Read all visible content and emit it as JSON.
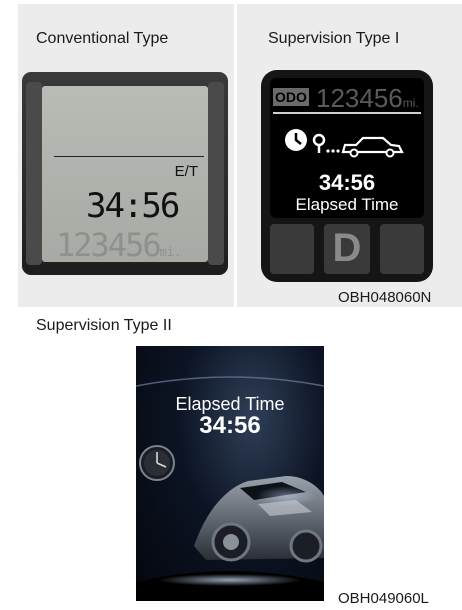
{
  "conventional": {
    "heading": "Conventional Type",
    "indicator": "E/T",
    "time": "34:56",
    "ghost_odometer": "123456",
    "ghost_unit": "mi."
  },
  "supervision_1": {
    "heading": "Supervision Type I",
    "odo_label": "ODO",
    "odometer": "123456",
    "odometer_unit": "mi.",
    "time": "34:56",
    "label": "Elapsed Time",
    "gear": "D",
    "ref_code": "OBH048060N"
  },
  "supervision_2": {
    "heading": "Supervision Type II",
    "label": "Elapsed Time",
    "time": "34:56",
    "ref_code": "OBH049060L"
  },
  "icons": [
    "route-clock-icon",
    "location-pin-icon",
    "car-outline-icon",
    "analog-clock-icon",
    "car-photo"
  ]
}
